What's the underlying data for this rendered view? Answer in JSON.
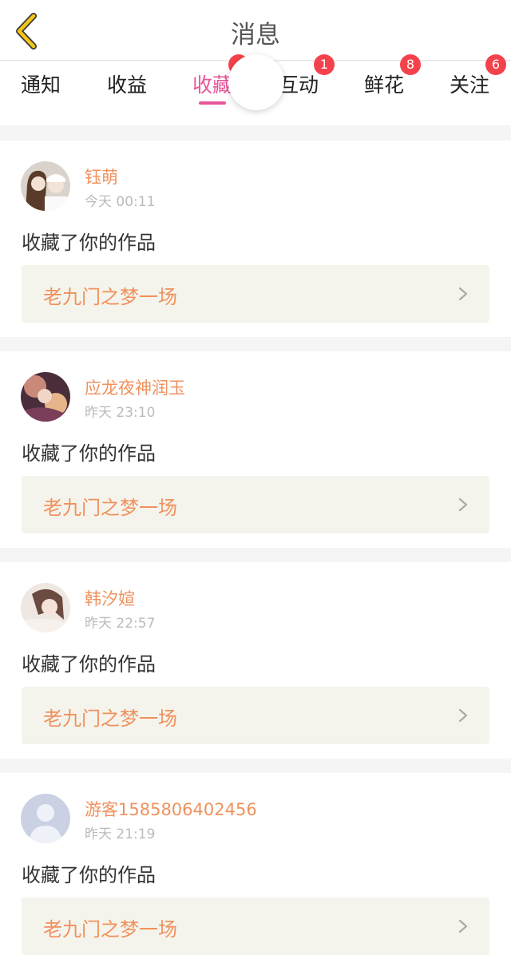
{
  "header": {
    "title": "消息"
  },
  "tabs": [
    {
      "label": "通知",
      "badge": ""
    },
    {
      "label": "收益",
      "badge": ""
    },
    {
      "label": "收藏",
      "badge": ""
    },
    {
      "label": "互动",
      "badge": "1"
    },
    {
      "label": "鲜花",
      "badge": "8"
    },
    {
      "label": "关注",
      "badge": "6"
    }
  ],
  "colors": {
    "accent": "#e8559a",
    "name": "#f0915d",
    "badge": "#f4424c",
    "back_icon": "#f5c518"
  },
  "messages": [
    {
      "user": "钰萌",
      "time": "今天 00:11",
      "action": "收藏了你的作品",
      "work": "老九门之梦一场"
    },
    {
      "user": "应龙夜神润玉",
      "time": "昨天 23:10",
      "action": "收藏了你的作品",
      "work": "老九门之梦一场"
    },
    {
      "user": "韩汐媗",
      "time": "昨天 22:57",
      "action": "收藏了你的作品",
      "work": "老九门之梦一场"
    },
    {
      "user": "游客1585806402456",
      "time": "昨天 21:19",
      "action": "收藏了你的作品",
      "work": "老九门之梦一场"
    }
  ]
}
